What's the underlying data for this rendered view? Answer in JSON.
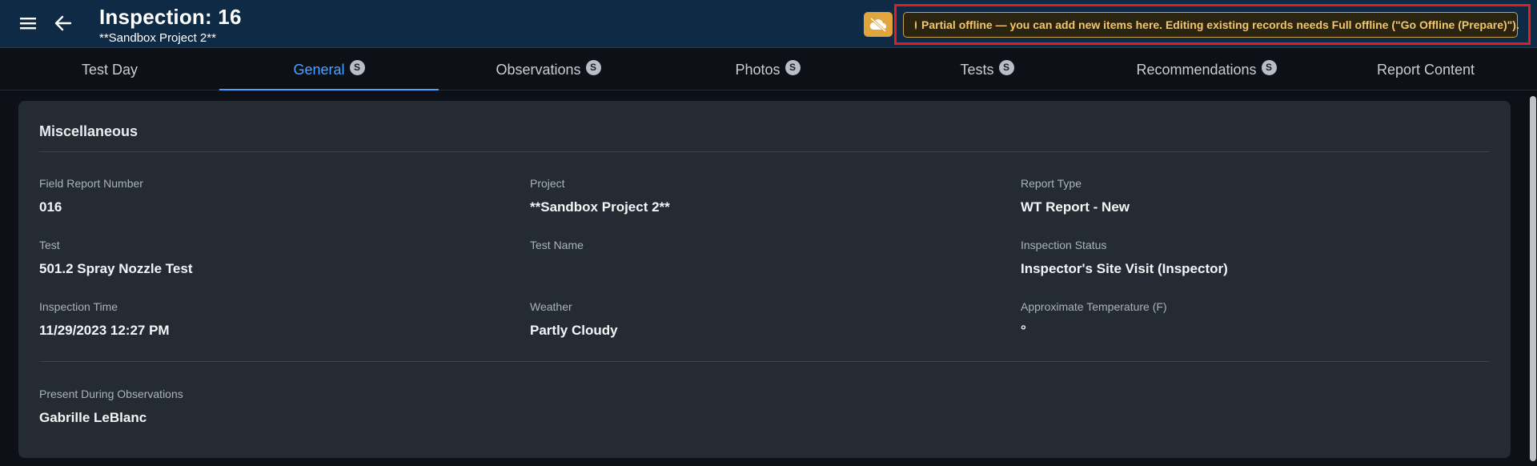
{
  "header": {
    "title": "Inspection: 16",
    "subtitle": "**Sandbox Project 2**",
    "offline_banner": "Partial offline — you can add new items here. Editing existing records needs Full offline (\"Go Offline (Prepare)\")."
  },
  "tabs": [
    {
      "label": "Test Day",
      "badge": ""
    },
    {
      "label": "General",
      "badge": "S"
    },
    {
      "label": "Observations",
      "badge": "S"
    },
    {
      "label": "Photos",
      "badge": "S"
    },
    {
      "label": "Tests",
      "badge": "S"
    },
    {
      "label": "Recommendations",
      "badge": "S"
    },
    {
      "label": "Report Content",
      "badge": ""
    }
  ],
  "section": {
    "title": "Miscellaneous",
    "fields": {
      "field_report_number": {
        "label": "Field Report Number",
        "value": "016"
      },
      "project": {
        "label": "Project",
        "value": "**Sandbox Project 2**"
      },
      "report_type": {
        "label": "Report Type",
        "value": "WT Report - New"
      },
      "test": {
        "label": "Test",
        "value": "501.2 Spray Nozzle Test"
      },
      "test_name": {
        "label": "Test Name",
        "value": ""
      },
      "inspection_status": {
        "label": "Inspection Status",
        "value": "Inspector's Site Visit (Inspector)"
      },
      "inspection_time": {
        "label": "Inspection Time",
        "value": "11/29/2023 12:27 PM"
      },
      "weather": {
        "label": "Weather",
        "value": "Partly Cloudy"
      },
      "approx_temp": {
        "label": "Approximate Temperature (F)",
        "value": "°"
      },
      "present_during": {
        "label": "Present During Observations",
        "value": "Gabrille LeBlanc"
      }
    }
  },
  "colors": {
    "header_bg": "#0e2a44",
    "accent": "#4aa3ff",
    "warning": "#e0a53c",
    "highlight": "#e02020"
  }
}
